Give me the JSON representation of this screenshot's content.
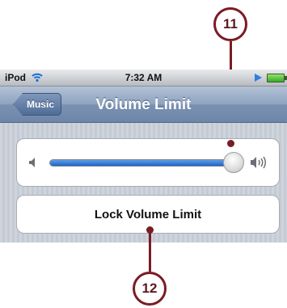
{
  "statusbar": {
    "carrier": "iPod",
    "time": "7:32 AM",
    "wifi_icon": "wifi-icon",
    "play_icon": "play-icon",
    "battery_icon": "battery-icon"
  },
  "navbar": {
    "back_label": "Music",
    "title": "Volume Limit"
  },
  "volume_slider": {
    "level": 0.95,
    "min_icon": "volume-low-icon",
    "max_icon": "volume-high-icon",
    "accent": "#1c64c8"
  },
  "lock_button": {
    "label": "Lock Volume Limit"
  },
  "callouts": [
    {
      "label": "11"
    },
    {
      "label": "12"
    }
  ]
}
